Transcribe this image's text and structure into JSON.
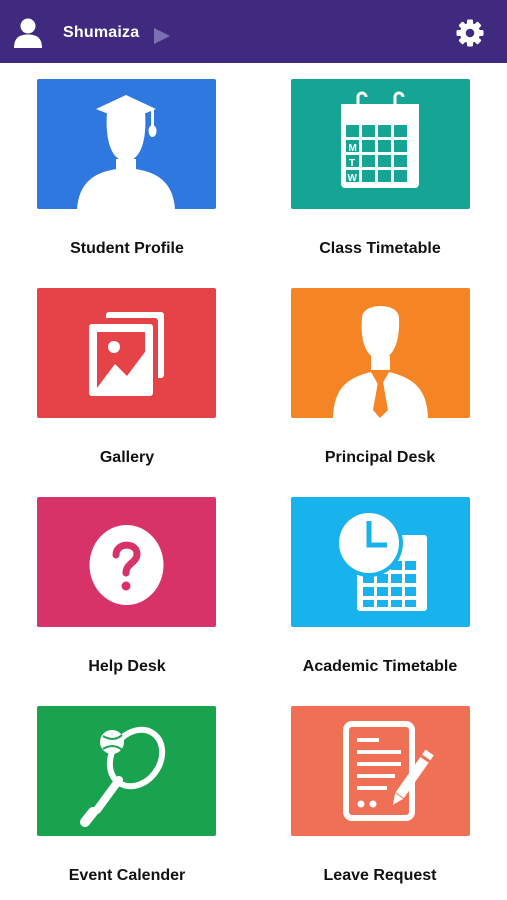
{
  "header": {
    "username": "Shumaiza",
    "background": "#3f2a80",
    "icons": [
      "user-icon",
      "play-triangle-icon",
      "gear-icon"
    ]
  },
  "tiles": [
    {
      "label": "Student Profile",
      "color": "#2f78e0",
      "icon": "graduate-icon"
    },
    {
      "label": "Class Timetable",
      "color": "#16a595",
      "icon": "calendar-icon"
    },
    {
      "label": "Gallery",
      "color": "#e64349",
      "icon": "photos-icon"
    },
    {
      "label": "Principal Desk",
      "color": "#f58424",
      "icon": "businessman-icon"
    },
    {
      "label": "Help Desk",
      "color": "#d73368",
      "icon": "question-icon"
    },
    {
      "label": "Academic Timetable",
      "color": "#18b3ec",
      "icon": "clock-calculator-icon"
    },
    {
      "label": "Event Calender",
      "color": "#1aa34e",
      "icon": "tennis-racket-icon"
    },
    {
      "label": "Leave Request",
      "color": "#ef7055",
      "icon": "document-pen-icon"
    }
  ],
  "calendar_letters": [
    "M",
    "T",
    "W"
  ]
}
